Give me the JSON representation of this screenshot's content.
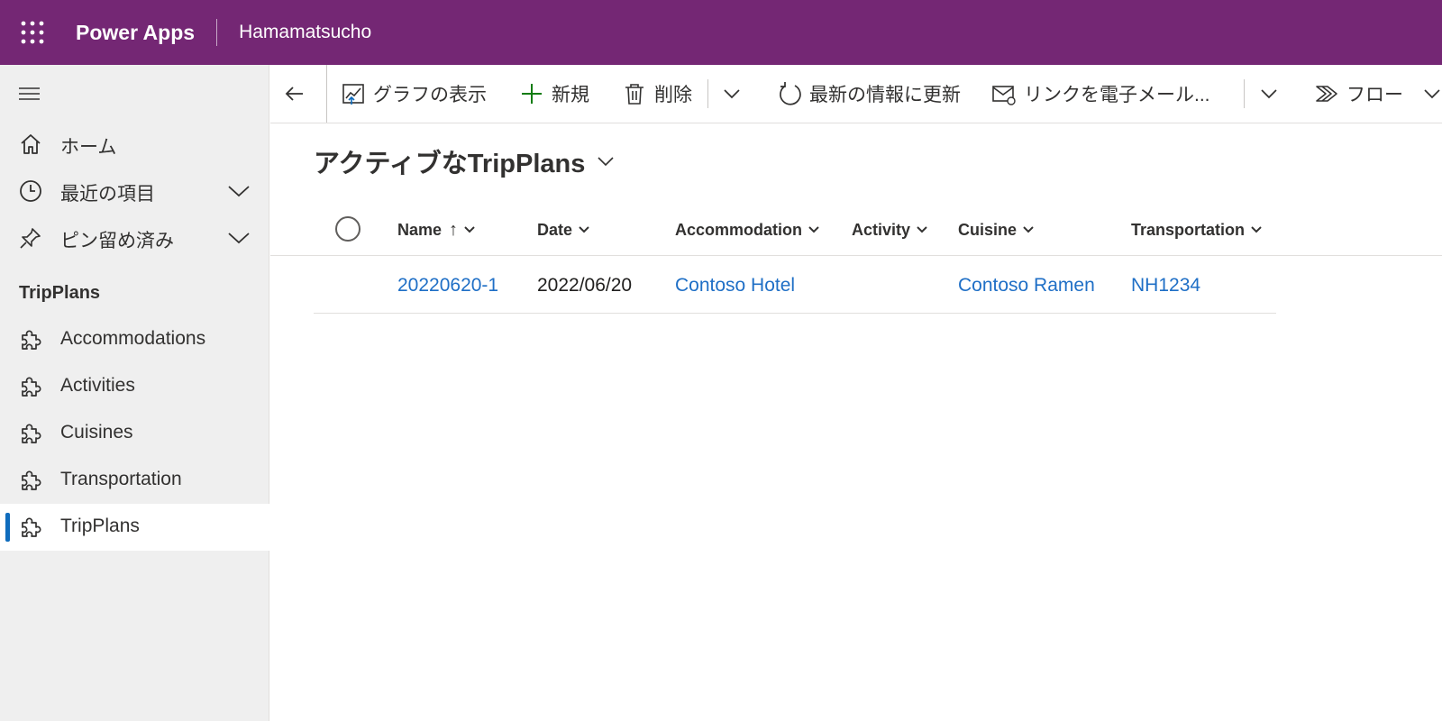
{
  "header": {
    "app_name": "Power Apps",
    "environment": "Hamamatsucho",
    "background_color": "#742774"
  },
  "sidebar": {
    "top_items": [
      {
        "label": "ホーム",
        "icon": "home-icon"
      },
      {
        "label": "最近の項目",
        "icon": "clock-icon",
        "expandable": true
      },
      {
        "label": "ピン留め済み",
        "icon": "pin-icon",
        "expandable": true
      }
    ],
    "section_title": "TripPlans",
    "tables": [
      {
        "label": "Accommodations",
        "icon": "puzzle-icon"
      },
      {
        "label": "Activities",
        "icon": "puzzle-icon"
      },
      {
        "label": "Cuisines",
        "icon": "puzzle-icon"
      },
      {
        "label": "Transportation",
        "icon": "puzzle-icon"
      },
      {
        "label": "TripPlans",
        "icon": "puzzle-icon",
        "selected": true
      }
    ]
  },
  "commandbar": {
    "back": "back-arrow-icon",
    "show_chart": "グラフの表示",
    "new": "新規",
    "delete": "削除",
    "refresh": "最新の情報に更新",
    "email_link": "リンクを電子メール...",
    "flow": "フロー"
  },
  "view": {
    "title": "アクティブなTripPlans"
  },
  "grid": {
    "columns": {
      "name": "Name",
      "name_sort": "↑",
      "date": "Date",
      "accommodation": "Accommodation",
      "activity": "Activity",
      "cuisine": "Cuisine",
      "transportation": "Transportation"
    },
    "rows": [
      {
        "name": "20220620-1",
        "date": "2022/06/20",
        "accommodation": "Contoso Hotel",
        "activity": "",
        "cuisine": "Contoso Ramen",
        "transportation": "NH1234"
      }
    ]
  },
  "colors": {
    "link": "#1f6fc6",
    "selected_indicator": "#0f6cbd",
    "sidebar_bg": "#efefef",
    "add_icon": "#107c10"
  }
}
